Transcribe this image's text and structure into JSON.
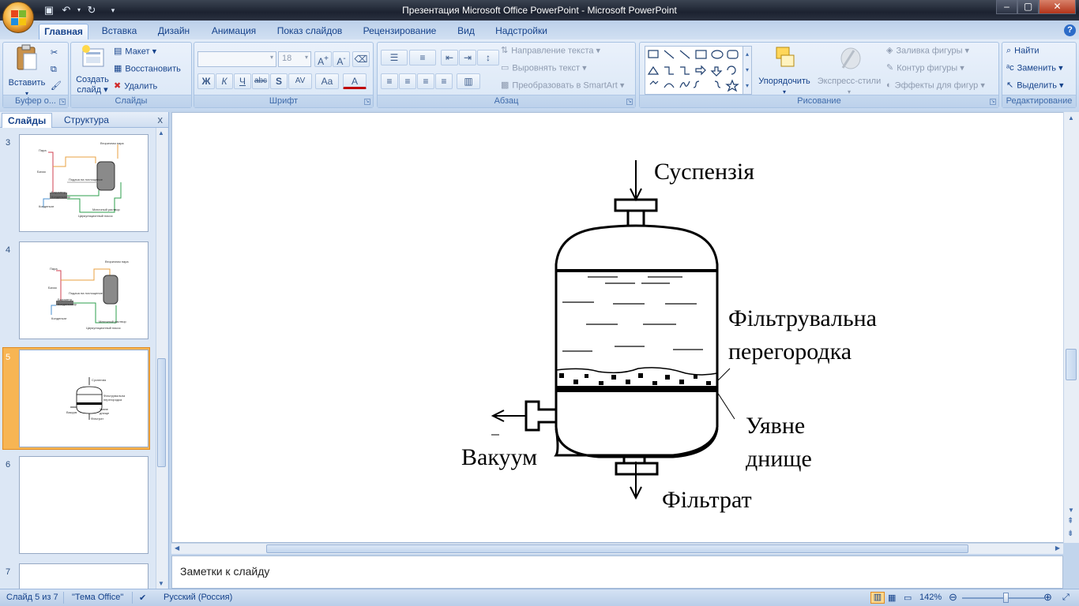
{
  "title": "Презентация Microsoft Office PowerPoint - Microsoft PowerPoint",
  "window_controls": {
    "minimize": "–",
    "maximize": "▢",
    "close": "✕"
  },
  "tabs": [
    "Главная",
    "Вставка",
    "Дизайн",
    "Анимация",
    "Показ слайдов",
    "Рецензирование",
    "Вид",
    "Надстройки"
  ],
  "ribbon": {
    "clipboard": {
      "paste": "Вставить",
      "label": "Буфер о..."
    },
    "slides": {
      "create_line1": "Создать",
      "create_line2": "слайд",
      "layout": "Макет",
      "reset": "Восстановить",
      "delete": "Удалить",
      "label": "Слайды"
    },
    "font": {
      "font_size": "18",
      "label": "Шрифт",
      "bold": "Ж",
      "italic": "К",
      "underline": "Ч",
      "strike": "abc",
      "shadow": "S",
      "spacing": "AV",
      "case": "Aa",
      "color": "A"
    },
    "paragraph": {
      "text_direction": "Направление текста",
      "align_text": "Выровнять текст",
      "smartart": "Преобразовать в SmartArt",
      "label": "Абзац"
    },
    "drawing": {
      "arrange": "Упорядочить",
      "quick_styles": "Экспресс-стили",
      "fill": "Заливка фигуры",
      "outline": "Контур фигуры",
      "effects": "Эффекты для фигур",
      "label": "Рисование"
    },
    "editing": {
      "find": "Найти",
      "replace": "Заменить",
      "select": "Выделить",
      "label": "Редактирование"
    }
  },
  "panel": {
    "tab_slides": "Слайды",
    "tab_outline": "Структура",
    "close": "x"
  },
  "thumbnails": [
    {
      "number": "3",
      "labels": [
        "Пара",
        "Вторичная пара",
        "Бачок",
        "Барометр",
        "Подача на поглощение",
        "Конденсатор",
        "Конденсат",
        "Маточный раствор",
        "Циркуляционный насос"
      ]
    },
    {
      "number": "4",
      "labels": [
        "Пара",
        "Вторичная пара",
        "Бачок",
        "Барометр",
        "Подача на поглощение",
        "Конденсатор",
        "Конденсат",
        "Маточный раствор",
        "Циркуляционный насос"
      ]
    },
    {
      "number": "5",
      "labels": [
        "Суспензія",
        "Фільтрувальна",
        "перегородка",
        "Вакуум",
        "Уявне",
        "днище",
        "Фільтрат"
      ]
    },
    {
      "number": "6",
      "labels": []
    },
    {
      "number": "7",
      "labels": []
    }
  ],
  "slide": {
    "suspension": "Суспензія",
    "filter_line1": "Фільтрувальна",
    "filter_line2": "перегородка",
    "vacuum": "Вакуум",
    "bottom_line1": "Уявне",
    "bottom_line2": "днище",
    "filtrate": "Фільтрат"
  },
  "notes_placeholder": "Заметки к слайду",
  "status": {
    "slide_info": "Слайд 5 из 7",
    "theme": "\"Тема Office\"",
    "language": "Русский (Россия)",
    "zoom": "142%"
  }
}
